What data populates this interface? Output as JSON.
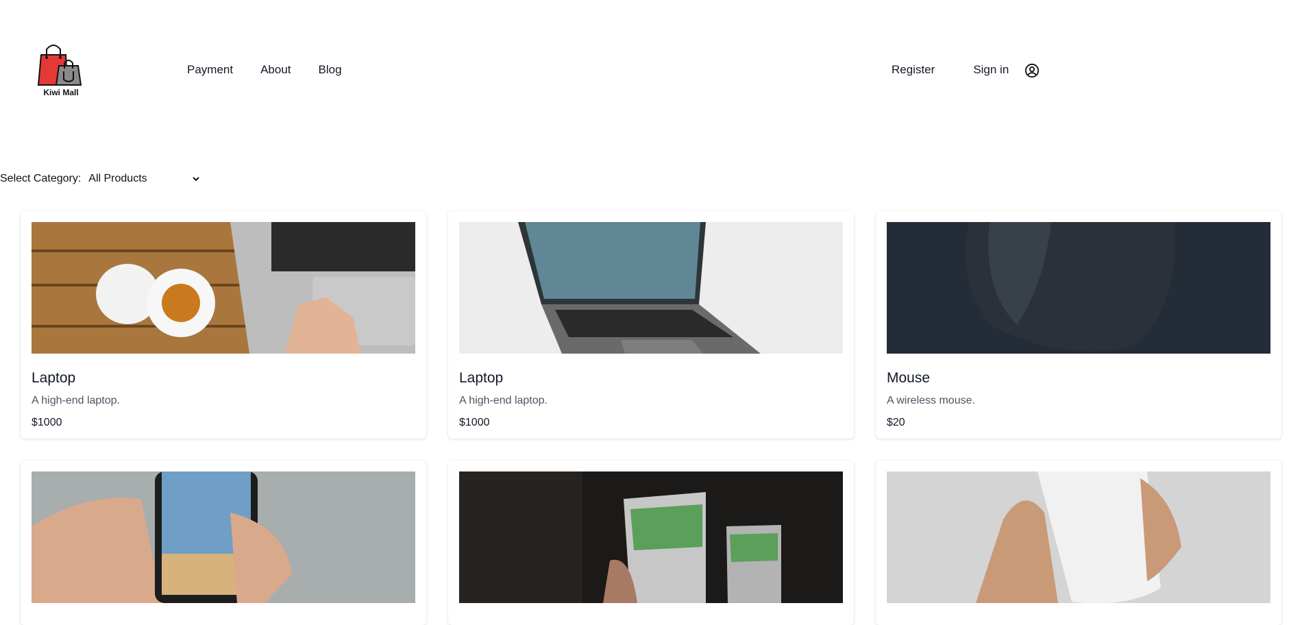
{
  "header": {
    "logo_text": "Kiwi Mall",
    "nav": [
      "Payment",
      "About",
      "Blog"
    ],
    "register_label": "Register",
    "signin_label": "Sign in"
  },
  "filter": {
    "label": "Select Category:",
    "selected": "All Products"
  },
  "products": [
    {
      "title": "Laptop",
      "description": "A high-end laptop.",
      "price": "$1000",
      "image": "laptop-on-desk-with-coffee"
    },
    {
      "title": "Laptop",
      "description": "A high-end laptop.",
      "price": "$1000",
      "image": "dell-laptop-open"
    },
    {
      "title": "Mouse",
      "description": "A wireless mouse.",
      "price": "$20",
      "image": "black-wireless-mouse"
    },
    {
      "title": "",
      "description": "",
      "price": "",
      "image": "smartphone-in-hand"
    },
    {
      "title": "",
      "description": "",
      "price": "",
      "image": "hard-drives"
    },
    {
      "title": "",
      "description": "",
      "price": "",
      "image": "white-phone-in-hand"
    }
  ],
  "colors": {
    "logo_bag_red": "#e53935",
    "logo_bag_gray": "#8a8a8a"
  }
}
